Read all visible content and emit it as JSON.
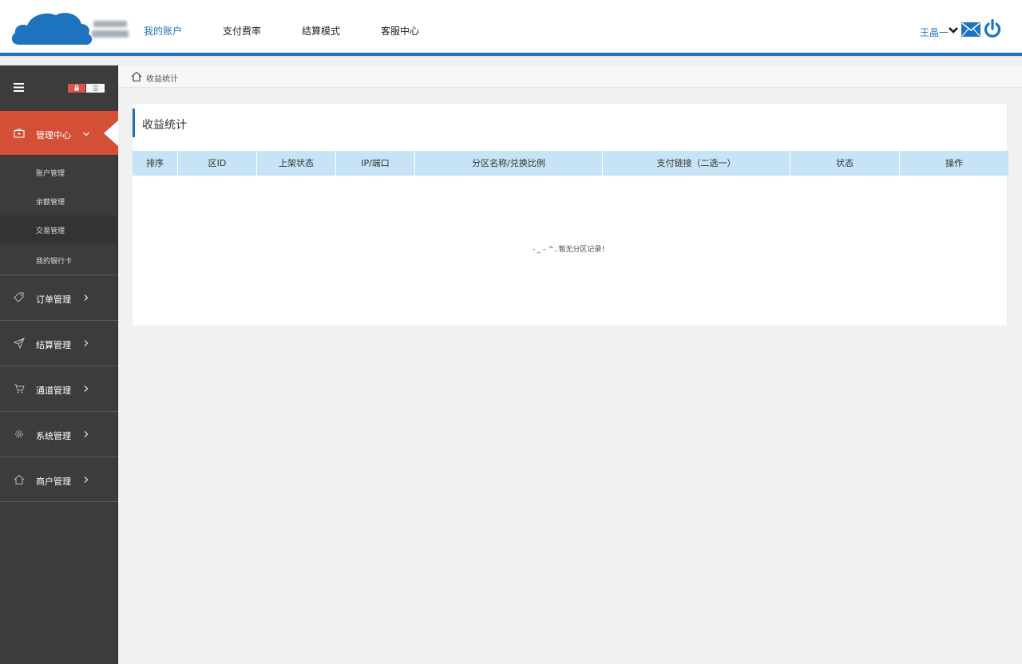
{
  "header": {
    "nav": [
      {
        "label": "我的账户",
        "active": true
      },
      {
        "label": "支付费率",
        "active": false
      },
      {
        "label": "结算模式",
        "active": false
      },
      {
        "label": "客服中心",
        "active": false
      }
    ],
    "user_name": "王晶一",
    "accent_color": "#1e73be"
  },
  "sidebar": {
    "active_group": {
      "label": "管理中心",
      "icon": "briefcase-icon"
    },
    "sub_items": [
      {
        "label": "账户管理",
        "selected": false
      },
      {
        "label": "余额管理",
        "selected": false
      },
      {
        "label": "交易管理",
        "selected": true
      },
      {
        "label": "我的银行卡",
        "selected": false
      }
    ],
    "groups": [
      {
        "label": "订单管理",
        "icon": "tag-icon"
      },
      {
        "label": "结算管理",
        "icon": "send-icon"
      },
      {
        "label": "通道管理",
        "icon": "cart-icon"
      },
      {
        "label": "系统管理",
        "icon": "gear-icon"
      },
      {
        "label": "商户管理",
        "icon": "home-icon"
      }
    ],
    "active_color": "#d35037"
  },
  "breadcrumb": {
    "text": "收益统计"
  },
  "panel": {
    "title": "收益统计",
    "columns": [
      "排序",
      "区ID",
      "上架状态",
      "IP/端口",
      "分区名称/兑换比例",
      "支付链接（二选一）",
      "状态",
      "操作"
    ],
    "empty_text": "- _ - ^..暂无分区记录！",
    "header_color": "#c6e3f7"
  }
}
